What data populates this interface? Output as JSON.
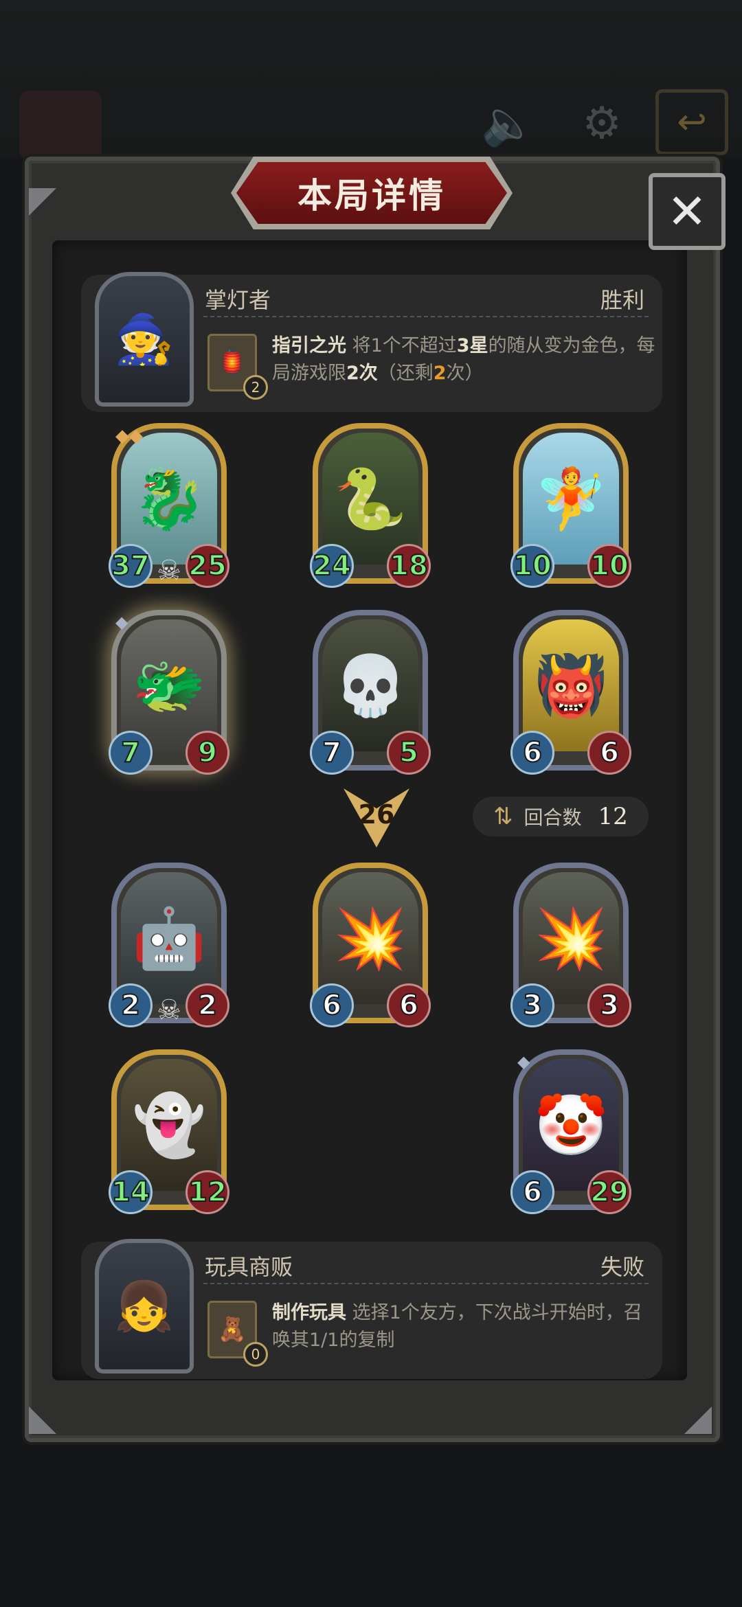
{
  "window": {
    "title": "本局详情"
  },
  "top_hero": {
    "name": "掌灯者",
    "result": "胜利",
    "skill_count": "2",
    "skill_name": "指引之光",
    "desc_part1": " 将1个不超过",
    "desc_star": "3星",
    "desc_part2": "的随从变为金色，每局游戏限",
    "desc_limit": "2次",
    "desc_part3": "（还剩",
    "desc_remaining": "2",
    "desc_part4": "次）"
  },
  "bottom_hero": {
    "name": "玩具商贩",
    "result": "失败",
    "skill_count": "0",
    "skill_name": "制作玩具",
    "desc": " 选择1个友方，下次战斗开始时，召唤其1/1的复制"
  },
  "top_board": [
    {
      "attack": "37",
      "health": "25"
    },
    {
      "attack": "24",
      "health": "18"
    },
    {
      "attack": "10",
      "health": "10"
    },
    {
      "attack": "7",
      "health": "9"
    },
    {
      "attack": "7",
      "health": "5"
    },
    {
      "attack": "6",
      "health": "6"
    }
  ],
  "bottom_board": [
    {
      "attack": "2",
      "health": "2"
    },
    {
      "attack": "6",
      "health": "6"
    },
    {
      "attack": "3",
      "health": "3"
    },
    {
      "attack": "14",
      "health": "12"
    },
    {
      "attack": "6",
      "health": "29"
    }
  ],
  "damage": "26",
  "round": {
    "label": "回合数",
    "value": "12"
  },
  "icons": {
    "close": "close-icon",
    "speaker": "speaker-icon",
    "settings": "gear-icon",
    "exit": "exit-icon",
    "round": "refresh-icon"
  },
  "colors": {
    "title_banner": "#8a1d1d",
    "gold_frame": "#c79a3c",
    "silver_frame": "#6e7690",
    "attack": "#2d5c86",
    "health": "#7e1f24",
    "buffed_stat": "#7ff07f",
    "highlight": "#e99a2c"
  }
}
